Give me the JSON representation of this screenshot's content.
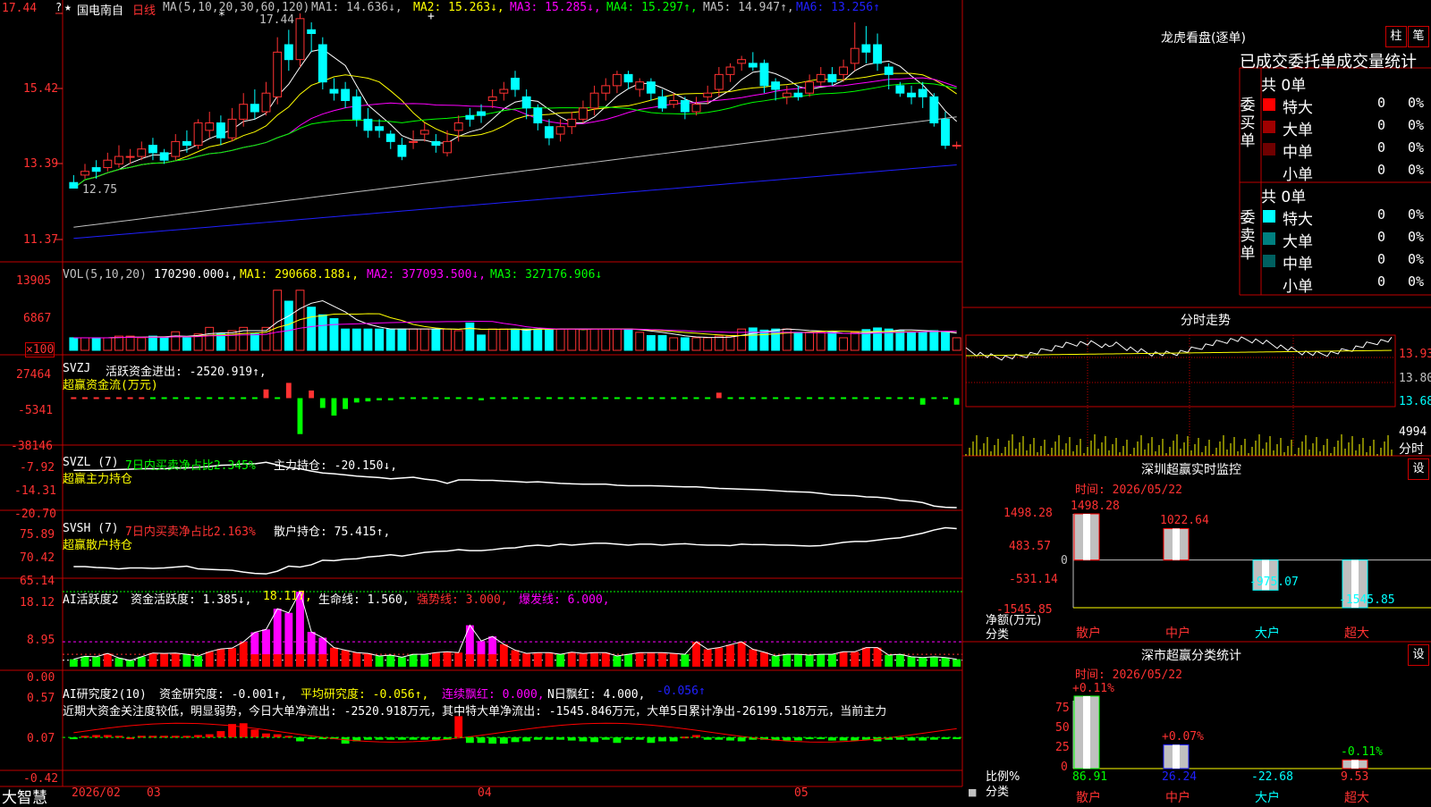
{
  "app": {
    "logo": "大智慧",
    "star": "★",
    "stock_name": "国电南自",
    "period": "日线",
    "menu_icon": "?"
  },
  "header": {
    "ma_label": "MA(5,10,20,30,60,120)",
    "ma1": "MA1: 14.636↓,",
    "ma2": "MA2: 15.263↓,",
    "ma3": "MA3: 15.285↓,",
    "ma4": "MA4: 15.297↑,",
    "ma5": "MA5: 14.947↑,",
    "ma6": "MA6: 13.256↑",
    "high_mark": "17.44",
    "low_mark": "12.75",
    "cross_mark_1": "*",
    "cross_mark_2": "+"
  },
  "price_axis": [
    "17.44",
    "15.42",
    "13.39",
    "11.37"
  ],
  "vol": {
    "label": "VOL(5,10,20)",
    "value": "170290.000↓,",
    "ma1": "MA1: 290668.188↓,",
    "ma2": "MA2: 377093.500↓,",
    "ma3": "MA3: 327176.906↓",
    "axis": [
      "13905",
      "6867"
    ],
    "unit": "×100"
  },
  "svzj": {
    "label": "SVZJ",
    "sub": "活跃资金进出: -2520.919↑,",
    "name": "超赢资金流(万元)",
    "axis": [
      "27464",
      "-5341",
      "-38146"
    ]
  },
  "svzl": {
    "label": "SVZL (7)",
    "sub": "7日内买卖净占比2.345%",
    "hold": "主力持仓: -20.150↓,",
    "name": "超赢主力持仓",
    "axis": [
      "-7.92",
      "-14.31",
      "-20.70"
    ]
  },
  "svsh": {
    "label": "SVSH (7)",
    "sub": "7日内买卖净占比2.163%",
    "hold": "散户持仓: 75.415↑,",
    "name": "超赢散户持仓",
    "axis": [
      "75.89",
      "70.42",
      "65.14"
    ]
  },
  "ai1": {
    "label": "AI活跃度2",
    "a": "资金活跃度: 1.385↓,",
    "b": "18.117,",
    "c": "生命线: 1.560,",
    "d": "强势线: 3.000,",
    "e": "爆发线: 6.000,",
    "axis": [
      "18.12",
      "8.95",
      "0.00"
    ]
  },
  "ai2": {
    "label": "AI研究度2(10)",
    "a": "资金研究度: -0.001↑,",
    "b": "平均研究度: -0.056↑,",
    "c": "连续飘红: 0.000,",
    "d": "N日飘红: 4.000,",
    "e": "-0.056↑",
    "axis": [
      "0.57",
      "0.07",
      "-0.42"
    ],
    "note": "近期大资金关注度较低，明显弱势，今日大单净流出: -2520.918万元，其中特大单净流出: -1545.846万元，大单5日累计净出-26199.518万元，当前主力"
  },
  "date_axis": [
    "2026/02",
    "03",
    "04",
    "05"
  ],
  "lhb": {
    "title": "龙虎看盘(逐单)",
    "btn1": "柱",
    "btn2": "笔",
    "header": "已成交委托单成交量统计",
    "buy_label": "委买单",
    "buy_total": "共 0单",
    "buy_rows": [
      {
        "name": "特大",
        "count": "0",
        "pct": "0%",
        "color": "#ff0000"
      },
      {
        "name": "大单",
        "count": "0",
        "pct": "0%",
        "color": "#a00000"
      },
      {
        "name": "中单",
        "count": "0",
        "pct": "0%",
        "color": "#700000"
      },
      {
        "name": "小单",
        "count": "0",
        "pct": "0%",
        "color": ""
      }
    ],
    "sell_label": "委卖单",
    "sell_total": "共 0单",
    "sell_rows": [
      {
        "name": "特大",
        "count": "0",
        "pct": "0%",
        "color": "#00ffff"
      },
      {
        "name": "大单",
        "count": "0",
        "pct": "0%",
        "color": "#008080"
      },
      {
        "name": "中单",
        "count": "0",
        "pct": "0%",
        "color": "#006060"
      },
      {
        "name": "小单",
        "count": "0",
        "pct": "0%",
        "color": ""
      }
    ]
  },
  "intraday": {
    "title": "分时走势",
    "axis": [
      "13.93",
      "13.80",
      "13.68"
    ],
    "vol_label": "4994",
    "unit": "分时"
  },
  "sz_monitor": {
    "title": "深圳超赢实时监控",
    "btn": "设",
    "time": "时间: 2026/05/22",
    "axis": [
      "1498.28",
      "483.57",
      "0",
      "-531.14",
      "-1545.85"
    ],
    "ylabel": "净额(万元)",
    "xlabel": "分类"
  },
  "sz_class": {
    "title": "深市超赢分类统计",
    "btn": "设",
    "time": "时间: 2026/05/22",
    "axis": [
      "75",
      "50",
      "25",
      "0"
    ],
    "ylabel": "比例%",
    "xlabel": "分类"
  },
  "colors": {
    "up": "#ff3232",
    "down": "#00ffff",
    "frame": "#c00000",
    "ma5": "#ffffff",
    "ma10": "#ffff00",
    "ma20": "#ff00ff",
    "ma30": "#00ff00",
    "ma60": "#c0c0c0",
    "ma120": "#2020ff"
  },
  "chart_data": [
    {
      "type": "candlestick",
      "title": "国电南自 日线",
      "dates_shown": [
        "2026/02",
        "03",
        "04",
        "05"
      ],
      "ylim": [
        11.37,
        17.44
      ],
      "high": 17.44,
      "low": 12.75,
      "ohlc": [
        [
          12.9,
          12.75,
          13.1,
          12.75
        ],
        [
          13.1,
          13.2,
          13.4,
          13.0
        ],
        [
          13.3,
          13.2,
          13.5,
          13.0
        ],
        [
          13.3,
          13.5,
          13.7,
          13.2
        ],
        [
          13.4,
          13.6,
          13.9,
          13.3
        ],
        [
          13.6,
          13.6,
          13.8,
          13.4
        ],
        [
          13.6,
          13.8,
          14.0,
          13.5
        ],
        [
          13.9,
          13.7,
          14.1,
          13.5
        ],
        [
          13.7,
          13.5,
          13.8,
          13.4
        ],
        [
          13.6,
          14.0,
          14.2,
          13.5
        ],
        [
          14.0,
          13.9,
          14.3,
          13.7
        ],
        [
          13.9,
          14.5,
          14.6,
          13.8
        ],
        [
          14.3,
          14.5,
          14.8,
          14.1
        ],
        [
          14.5,
          14.1,
          14.7,
          13.9
        ],
        [
          14.1,
          14.6,
          14.9,
          14.0
        ],
        [
          14.6,
          15.0,
          15.3,
          14.4
        ],
        [
          15.0,
          14.8,
          15.4,
          14.6
        ],
        [
          14.8,
          15.3,
          15.6,
          14.7
        ],
        [
          15.2,
          16.4,
          16.8,
          15.0
        ],
        [
          16.6,
          16.2,
          17.0,
          15.9
        ],
        [
          16.2,
          17.3,
          17.44,
          16.0
        ],
        [
          17.0,
          16.9,
          17.2,
          16.4
        ],
        [
          16.6,
          15.6,
          16.8,
          15.4
        ],
        [
          15.4,
          15.3,
          15.7,
          15.1
        ],
        [
          15.4,
          15.1,
          15.6,
          14.9
        ],
        [
          15.2,
          14.6,
          15.4,
          14.4
        ],
        [
          14.6,
          14.3,
          14.9,
          14.1
        ],
        [
          14.4,
          14.3,
          14.6,
          14.1
        ],
        [
          14.2,
          14.0,
          14.3,
          13.8
        ],
        [
          13.9,
          13.6,
          14.1,
          13.5
        ],
        [
          14.0,
          14.0,
          14.3,
          13.8
        ],
        [
          14.2,
          14.3,
          14.5,
          14.0
        ],
        [
          14.0,
          13.9,
          14.2,
          13.7
        ],
        [
          13.7,
          14.0,
          14.3,
          13.6
        ],
        [
          14.3,
          14.5,
          14.7,
          14.0
        ],
        [
          14.7,
          14.6,
          14.9,
          14.4
        ],
        [
          14.8,
          14.7,
          15.0,
          14.5
        ],
        [
          15.1,
          15.2,
          15.4,
          14.9
        ],
        [
          15.3,
          15.4,
          15.6,
          15.1
        ],
        [
          15.7,
          15.4,
          15.9,
          15.2
        ],
        [
          15.2,
          14.9,
          15.4,
          14.6
        ],
        [
          14.9,
          14.5,
          15.0,
          14.3
        ],
        [
          14.4,
          14.1,
          14.6,
          13.9
        ],
        [
          14.2,
          14.4,
          14.6,
          14.0
        ],
        [
          14.4,
          14.6,
          14.8,
          14.2
        ],
        [
          14.6,
          14.9,
          15.1,
          14.5
        ],
        [
          14.9,
          15.3,
          15.5,
          14.7
        ],
        [
          15.3,
          15.5,
          15.7,
          15.1
        ],
        [
          15.5,
          15.8,
          15.9,
          15.3
        ],
        [
          15.8,
          15.6,
          15.9,
          15.4
        ],
        [
          15.4,
          15.6,
          15.7,
          15.2
        ],
        [
          15.6,
          15.3,
          15.7,
          15.1
        ],
        [
          15.2,
          14.9,
          15.4,
          14.8
        ],
        [
          15.0,
          15.1,
          15.3,
          14.9
        ],
        [
          15.1,
          14.8,
          15.2,
          14.6
        ],
        [
          14.8,
          15.0,
          15.2,
          14.7
        ],
        [
          15.2,
          15.3,
          15.5,
          15.0
        ],
        [
          15.4,
          15.8,
          16.0,
          15.2
        ],
        [
          15.8,
          16.0,
          16.1,
          15.6
        ],
        [
          16.1,
          16.2,
          16.3,
          15.9
        ],
        [
          16.1,
          16.0,
          16.4,
          15.9
        ],
        [
          16.1,
          15.5,
          16.2,
          15.3
        ],
        [
          15.6,
          15.4,
          15.7,
          15.1
        ],
        [
          15.2,
          15.3,
          15.5,
          15.0
        ],
        [
          15.3,
          15.2,
          15.5,
          15.1
        ],
        [
          15.3,
          15.6,
          15.8,
          15.2
        ],
        [
          15.6,
          15.8,
          16.0,
          15.5
        ],
        [
          15.8,
          15.6,
          16.0,
          15.5
        ],
        [
          15.8,
          16.0,
          16.2,
          15.6
        ],
        [
          16.1,
          16.5,
          17.2,
          15.9
        ],
        [
          16.6,
          16.4,
          17.1,
          16.1
        ],
        [
          16.6,
          16.1,
          16.9,
          15.9
        ],
        [
          16.0,
          15.8,
          16.1,
          15.4
        ],
        [
          15.5,
          15.3,
          15.6,
          15.2
        ],
        [
          15.3,
          15.2,
          15.5,
          15.0
        ],
        [
          15.4,
          15.2,
          15.6,
          14.9
        ],
        [
          15.2,
          14.5,
          15.3,
          14.4
        ],
        [
          14.6,
          13.9,
          14.8,
          13.8
        ],
        [
          13.9,
          13.9,
          14.0,
          13.8
        ]
      ]
    },
    {
      "type": "bar",
      "title": "VOL(5,10,20)",
      "ylim": [
        0,
        13905
      ],
      "unit": "×100",
      "values": [
        2300,
        2300,
        2300,
        2300,
        2600,
        2600,
        2300,
        2600,
        2300,
        3400,
        2300,
        3000,
        4200,
        3000,
        3600,
        4200,
        3000,
        4200,
        11000,
        9000,
        11000,
        7900,
        6500,
        5800,
        3900,
        3900,
        3900,
        3900,
        3900,
        3900,
        3900,
        3900,
        3900,
        3900,
        3600,
        5000,
        2800,
        3900,
        3900,
        3900,
        3900,
        3900,
        3900,
        3900,
        3900,
        3900,
        3900,
        3900,
        3900,
        3900,
        3300,
        2700,
        2700,
        2300,
        2300,
        2300,
        2300,
        2600,
        2600,
        3900,
        4100,
        3700,
        3900,
        3900,
        3300,
        3300,
        3300,
        3300,
        2300,
        3300,
        3800,
        4100,
        3900,
        3600,
        3300,
        3300,
        3600,
        3300,
        2300
      ]
    },
    {
      "type": "bar",
      "title": "SVZJ 超赢资金流(万元)",
      "ylim": [
        -38146,
        27464
      ],
      "values": [
        -600,
        -600,
        -700,
        -700,
        -800,
        -800,
        -800,
        -1200,
        -1000,
        -1100,
        -1000,
        -1000,
        -1000,
        -1000,
        -1000,
        -1000,
        -1000,
        8000,
        -1500,
        14000,
        -33000,
        7000,
        -9000,
        -16000,
        -10000,
        -4000,
        -3000,
        -2000,
        -2000,
        -1500,
        -1500,
        -1500,
        -1500,
        -1500,
        -1800,
        -1500,
        -2000,
        -1500,
        -1500,
        -1500,
        -1500,
        -1500,
        -1500,
        -1500,
        -1500,
        -1500,
        -1500,
        -1500,
        -1500,
        -1500,
        -1500,
        -1500,
        -1500,
        -1500,
        -1500,
        -1500,
        -1500,
        5000,
        -1500,
        -1500,
        -1500,
        -1500,
        -1500,
        -1500,
        -1500,
        -1500,
        -1500,
        -1500,
        -1500,
        -1500,
        -1500,
        -1500,
        -1500,
        -1500,
        -1500,
        -6000,
        -1500,
        -1500,
        -6000
      ]
    },
    {
      "type": "line",
      "title": "SVZL 超赢主力持仓",
      "ylim": [
        -20.7,
        -7.92
      ],
      "values": [
        -11.0,
        -11.0,
        -11.0,
        -10.9,
        -10.8,
        -10.7,
        -10.6,
        -10.6,
        -10.6,
        -10.4,
        -10.4,
        -10.2,
        -10.0,
        -9.7,
        -9.6,
        -9.3,
        -9.3,
        -8.9,
        -9.6,
        -10.3,
        -10.6,
        -11.2,
        -11.7,
        -11.9,
        -12.2,
        -12.5,
        -12.7,
        -12.9,
        -13.2,
        -13.0,
        -12.8,
        -13.3,
        -13.6,
        -14.4,
        -13.5,
        -13.5,
        -13.6,
        -13.6,
        -13.8,
        -13.9,
        -14.1,
        -14.0,
        -14.2,
        -14.4,
        -14.5,
        -14.6,
        -14.6,
        -14.6,
        -14.9,
        -15.0,
        -15.0,
        -15.0,
        -15.1,
        -15.2,
        -15.3,
        -15.3,
        -15.5,
        -15.7,
        -15.8,
        -15.9,
        -16.0,
        -16.1,
        -16.3,
        -16.5,
        -16.6,
        -16.7,
        -17.0,
        -17.4,
        -17.5,
        -17.6,
        -17.9,
        -18.0,
        -18.3,
        -18.8,
        -19.0,
        -19.4,
        -20.3,
        -20.6,
        -20.7
      ]
    },
    {
      "type": "line",
      "title": "SVSH 超赢散户持仓",
      "ylim": [
        65.14,
        75.89
      ],
      "values": [
        66.9,
        66.9,
        66.7,
        66.6,
        66.4,
        66.6,
        66.6,
        66.5,
        66.6,
        66.8,
        67.0,
        66.4,
        66.3,
        66.2,
        66.1,
        65.7,
        65.4,
        65.3,
        65.9,
        67.0,
        66.8,
        67.3,
        68.3,
        68.2,
        68.5,
        68.6,
        69.0,
        69.2,
        69.5,
        69.2,
        69.6,
        70.0,
        70.2,
        70.3,
        70.6,
        70.4,
        70.4,
        70.6,
        70.9,
        71.0,
        71.4,
        71.6,
        71.4,
        71.8,
        71.6,
        71.8,
        72.0,
        72.0,
        71.8,
        71.6,
        71.8,
        71.8,
        71.6,
        71.8,
        71.9,
        71.7,
        71.6,
        71.6,
        71.5,
        71.8,
        71.7,
        71.7,
        71.6,
        71.6,
        71.5,
        71.4,
        71.5,
        71.8,
        72.2,
        72.4,
        72.4,
        72.7,
        73.0,
        73.2,
        73.7,
        74.2,
        74.9,
        75.4,
        75.2
      ]
    },
    {
      "type": "bar",
      "title": "AI活跃度2",
      "ylim": [
        0,
        18.12
      ],
      "values": [
        1.8,
        2.5,
        2.4,
        3.2,
        2.1,
        1.5,
        2.4,
        3.3,
        3.2,
        3.3,
        3.0,
        2.6,
        3.6,
        4.3,
        4.5,
        6.0,
        8.3,
        9.0,
        14.0,
        13.0,
        18.1,
        8.4,
        7.0,
        4.6,
        4.0,
        3.4,
        3.2,
        2.6,
        2.8,
        2.3,
        3.0,
        3.0,
        3.4,
        3.6,
        3.4,
        10.0,
        6.2,
        7.3,
        5.4,
        4.0,
        3.2,
        3.4,
        3.4,
        3.0,
        3.5,
        3.2,
        3.4,
        3.4,
        2.6,
        3.0,
        3.4,
        3.4,
        3.4,
        3.2,
        3.0,
        6.0,
        4.2,
        4.6,
        5.3,
        6.0,
        4.2,
        3.5,
        2.6,
        3.0,
        3.0,
        2.8,
        3.0,
        3.0,
        3.6,
        3.6,
        4.6,
        4.6,
        2.8,
        3.0,
        2.4,
        2.2,
        2.4,
        2.2,
        1.8
      ]
    },
    {
      "type": "bar",
      "title": "AI研究度2(10)",
      "ylim": [
        -0.42,
        0.57
      ],
      "values": [
        -0.02,
        0.02,
        0.03,
        0.03,
        0.02,
        0.0,
        0.02,
        0.02,
        0.02,
        0.02,
        0.02,
        0.03,
        0.04,
        0.08,
        0.17,
        0.18,
        0.1,
        0.05,
        0.04,
        0.02,
        -0.05,
        -0.02,
        -0.02,
        -0.02,
        -0.08,
        -0.05,
        -0.03,
        -0.03,
        -0.03,
        -0.03,
        -0.03,
        -0.03,
        -0.03,
        -0.03,
        0.27,
        -0.07,
        -0.07,
        -0.08,
        -0.08,
        -0.06,
        -0.05,
        -0.03,
        -0.03,
        -0.03,
        -0.04,
        -0.05,
        -0.06,
        -0.03,
        -0.07,
        -0.03,
        -0.03,
        -0.07,
        -0.05,
        -0.05,
        0.01,
        0.03,
        -0.03,
        -0.03,
        -0.04,
        -0.05,
        -0.03,
        -0.03,
        -0.04,
        -0.04,
        -0.04,
        -0.02,
        -0.02,
        -0.04,
        -0.04,
        -0.04,
        -0.03,
        -0.05,
        -0.03,
        -0.03,
        -0.04,
        -0.04,
        -0.03,
        -0.02,
        -0.02
      ]
    },
    {
      "type": "bar",
      "title": "深圳超赢实时监控",
      "categories": [
        "散户",
        "中户",
        "大户",
        "超大"
      ],
      "values": [
        1498.28,
        1022.64,
        -975.07,
        -1545.85
      ],
      "ylabel": "净额(万元)",
      "xlabel": "分类",
      "ylim": [
        -1545.85,
        1498.28
      ]
    },
    {
      "type": "bar",
      "title": "深市超赢分类统计",
      "categories": [
        "散户",
        "中户",
        "大户",
        "超大"
      ],
      "values": [
        86.91,
        26.24,
        -22.68,
        9.53
      ],
      "changes": [
        "+0.11%",
        "+0.07%",
        "",
        "-0.11%"
      ],
      "ylabel": "比例%",
      "xlabel": "分类",
      "ylim": [
        0,
        75
      ]
    }
  ]
}
